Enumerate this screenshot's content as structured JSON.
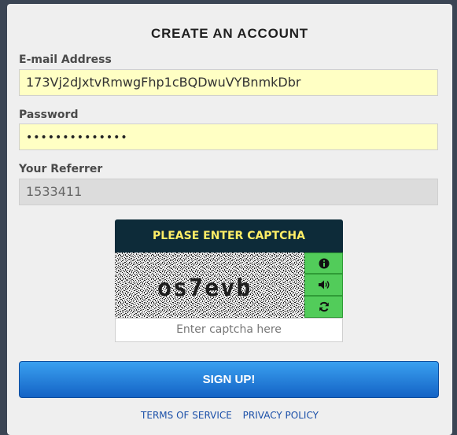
{
  "form": {
    "title": "CREATE AN ACCOUNT",
    "email_label": "E-mail Address",
    "email_value": "173Vj2dJxtvRmwgFhp1cBQDwuVYBnmkDbr",
    "password_label": "Password",
    "password_value": "••••••••••••••",
    "referrer_label": "Your Referrer",
    "referrer_value": "1533411"
  },
  "captcha": {
    "header": "PLEASE ENTER CAPTCHA",
    "image_text": "os7evb",
    "input_placeholder": "Enter captcha here",
    "buttons": [
      "info-icon",
      "audio-icon",
      "refresh-icon"
    ]
  },
  "actions": {
    "signup_label": "SIGN UP!"
  },
  "footer": {
    "terms_label": "TERMS OF SERVICE",
    "privacy_label": "PRIVACY POLICY"
  },
  "colors": {
    "background": "#3b4554",
    "card": "#efefef",
    "input_highlight": "#ffffc4",
    "captcha_header": "#0d2b39",
    "captcha_header_text": "#ffee66",
    "captcha_button": "#52cc5a",
    "button_blue": "#1a78dc",
    "link": "#1a4fa8"
  }
}
